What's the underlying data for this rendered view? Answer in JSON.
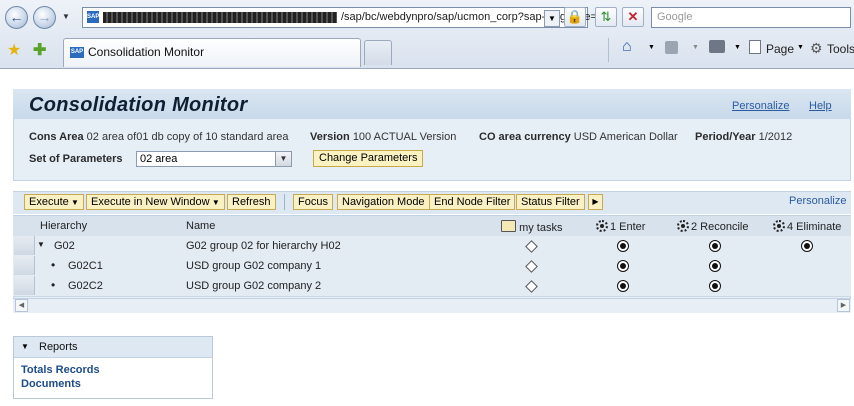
{
  "browser": {
    "url": "/sap/bc/webdynpro/sap/ucmon_corp?sap-language=EN",
    "search_placeholder": "Google",
    "tab_title": "Consolidation Monitor",
    "commands": {
      "page": "Page",
      "tools": "Tools"
    }
  },
  "header": {
    "title": "Consolidation Monitor",
    "links": [
      "Personalize",
      "Help"
    ],
    "cons_area_label": "Cons Area",
    "cons_area_value": "02 area of01 db copy of 10 standard area",
    "version_label": "Version",
    "version_value": "100 ACTUAL Version",
    "currency_label": "CO area currency",
    "currency_value": "USD American Dollar",
    "period_label": "Period/Year",
    "period_value": "1/2012",
    "params_label": "Set of Parameters",
    "params_value": "02 area",
    "change_params_button": "Change Parameters"
  },
  "toolbar": {
    "buttons": [
      "Execute",
      "Execute in New Window",
      "Refresh",
      "Focus",
      "Navigation Mode",
      "End Node Filter",
      "Status Filter"
    ],
    "personalize": "Personalize"
  },
  "table": {
    "columns": [
      "Hierarchy",
      "Name",
      "my tasks",
      "1 Enter",
      "2 Reconcile",
      "4 Eliminate"
    ],
    "rows": [
      {
        "hierarchy": "G02",
        "name": "G02 group 02 for hierarchy H02"
      },
      {
        "hierarchy": "G02C1",
        "name": "USD group G02 company 1"
      },
      {
        "hierarchy": "G02C2",
        "name": "USD group G02 company 2"
      }
    ]
  },
  "reports": {
    "title": "Reports",
    "links": [
      "Totals Records",
      "Documents"
    ]
  }
}
